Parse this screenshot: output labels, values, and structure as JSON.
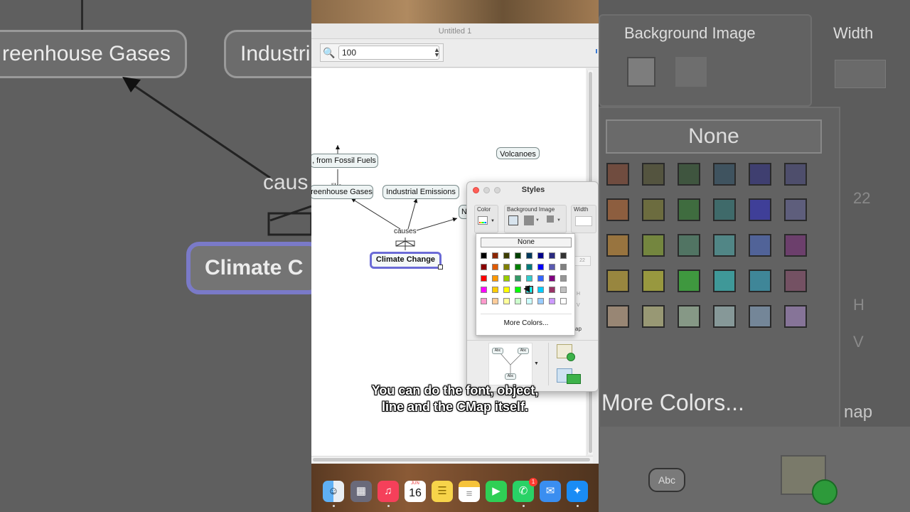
{
  "window": {
    "title": "Untitled 1"
  },
  "toolbar": {
    "zoom_value": "100"
  },
  "concept_map": {
    "nodes": {
      "fossil_fuels": ", from Fossil Fuels",
      "greenhouse_gases": "reenhouse Gases",
      "industrial_emissions": "Industrial Emissions",
      "volcanoes": "Volcanoes",
      "partial_n": "N",
      "climate_change": "Climate Change"
    },
    "links": {
      "like": "like",
      "causes": "causes"
    }
  },
  "styles_panel": {
    "title": "Styles",
    "headers": {
      "color": "Color",
      "background_image": "Background Image",
      "width": "Width"
    },
    "width_value": "22",
    "side_letters": {
      "h": "H",
      "v": "V"
    },
    "tab_fragment": "ap",
    "color_popover": {
      "none_label": "None",
      "more_colors_label": "More Colors...",
      "swatch_rows": [
        [
          "#000000",
          "#8b2500",
          "#3d3d00",
          "#004000",
          "#003a5c",
          "#00008b",
          "#2b2b80",
          "#333333"
        ],
        [
          "#8b0000",
          "#e05a00",
          "#808000",
          "#008000",
          "#007a7a",
          "#0000ff",
          "#5a5ab0",
          "#808080"
        ],
        [
          "#ff0000",
          "#ff9900",
          "#99cc00",
          "#339966",
          "#33cccc",
          "#3366ff",
          "#800080",
          "#969696"
        ],
        [
          "#ff00ff",
          "#ffcc00",
          "#ffff00",
          "#00ff00",
          "#00ffff",
          "#00ccff",
          "#993366",
          "#c0c0c0"
        ],
        [
          "#ff99cc",
          "#ffcc99",
          "#ffff99",
          "#ccffcc",
          "#ccffff",
          "#99ccff",
          "#cc99ff",
          "#ffffff"
        ]
      ]
    },
    "mini_map_node_label": "Abc"
  },
  "caption": {
    "line1": "You can do the font, object,",
    "line2": "line and the CMap itself."
  },
  "dock": {
    "calendar_month": "JUN",
    "calendar_day": "16",
    "whatsapp_badge": "1"
  },
  "background_zoom": {
    "left_node_1": "reenhouse Gases",
    "left_node_2": "Industri",
    "left_link": "caus",
    "left_node_3": "Climate C",
    "right_header_bg": "Background Image",
    "right_header_width": "Width",
    "right_none": "None",
    "right_width_value": "22",
    "right_more_colors": "More Colors...",
    "right_tab": "nap",
    "right_h": "H",
    "right_v": "V",
    "right_abc": "Abc"
  }
}
